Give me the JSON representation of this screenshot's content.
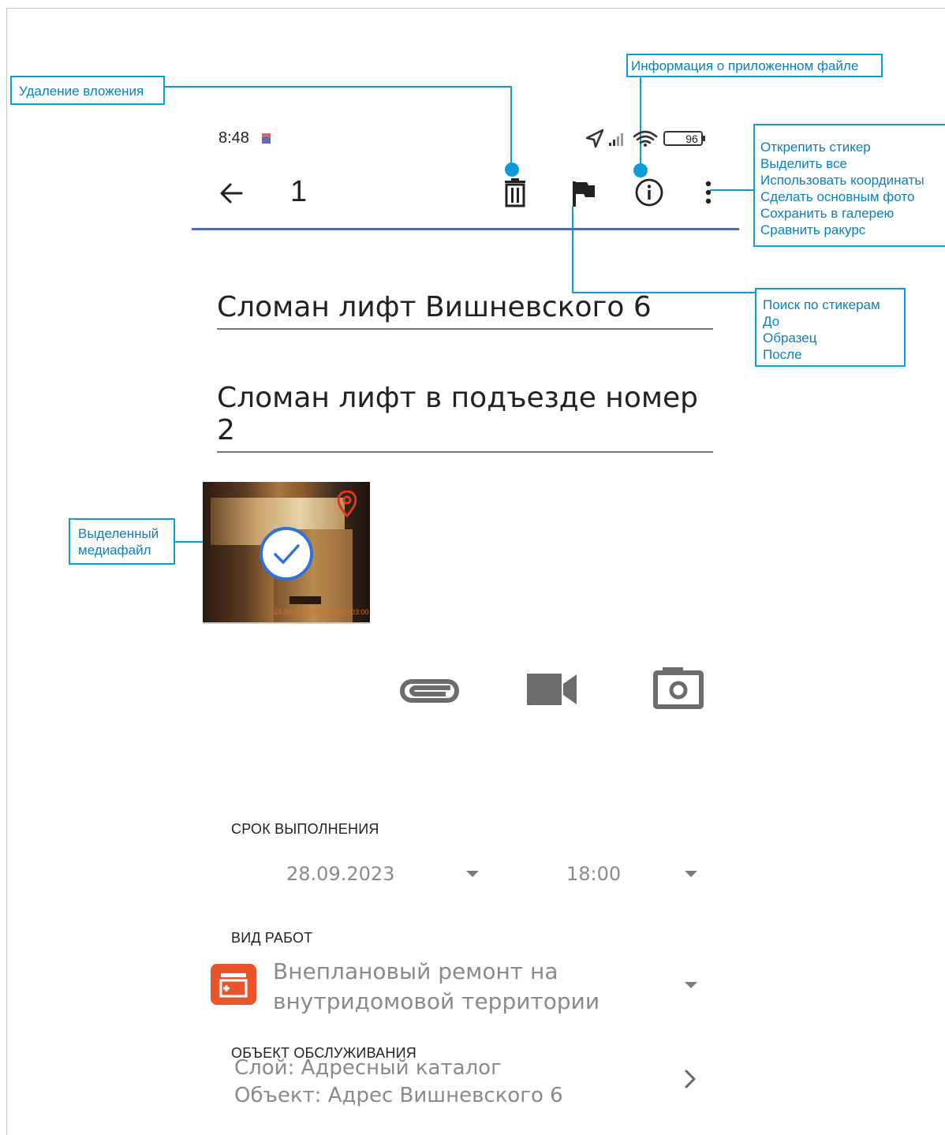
{
  "callouts": {
    "delete": "Удаление вложения",
    "info": "Информация о приложенном файле",
    "menu_items": [
      "Открепить стикер",
      "Выделить все",
      "Использовать координаты",
      "Сделать основным фото",
      "Сохранить в галерею",
      "Сравнить ракурс"
    ],
    "sticker_items": [
      "Поиск по стикерам",
      "До",
      "Образец",
      "После"
    ],
    "selected_lines": [
      "Выделенный",
      "медиафайл"
    ]
  },
  "status_bar": {
    "time": "8:48",
    "battery": "96"
  },
  "toolbar": {
    "selected_count": "1"
  },
  "form": {
    "title_value": "Сломан лифт Вишневского 6",
    "description_value": "Сломан лифт в подъезде номер 2"
  },
  "media": {
    "thumbnail_timestamp": "28.09.2023 08:46 GMT+03:00"
  },
  "deadline": {
    "label": "СРОК ВЫПОЛНЕНИЯ",
    "date": "28.09.2023",
    "time": "18:00"
  },
  "work_type": {
    "label": "ВИД РАБОТ",
    "value_lines": [
      "Внеплановый ремонт на",
      "внутридомовой территории"
    ]
  },
  "service_object": {
    "label": "ОБЪЕКТ ОБСЛУЖИВАНИЯ",
    "value_lines": [
      "Слой: Адресный каталог",
      "Объект: Адрес  Вишневского 6"
    ]
  },
  "colors": {
    "accent": "#2f72d9",
    "callout": "#0e9bd8",
    "work_type_icon": "#e9542a"
  }
}
